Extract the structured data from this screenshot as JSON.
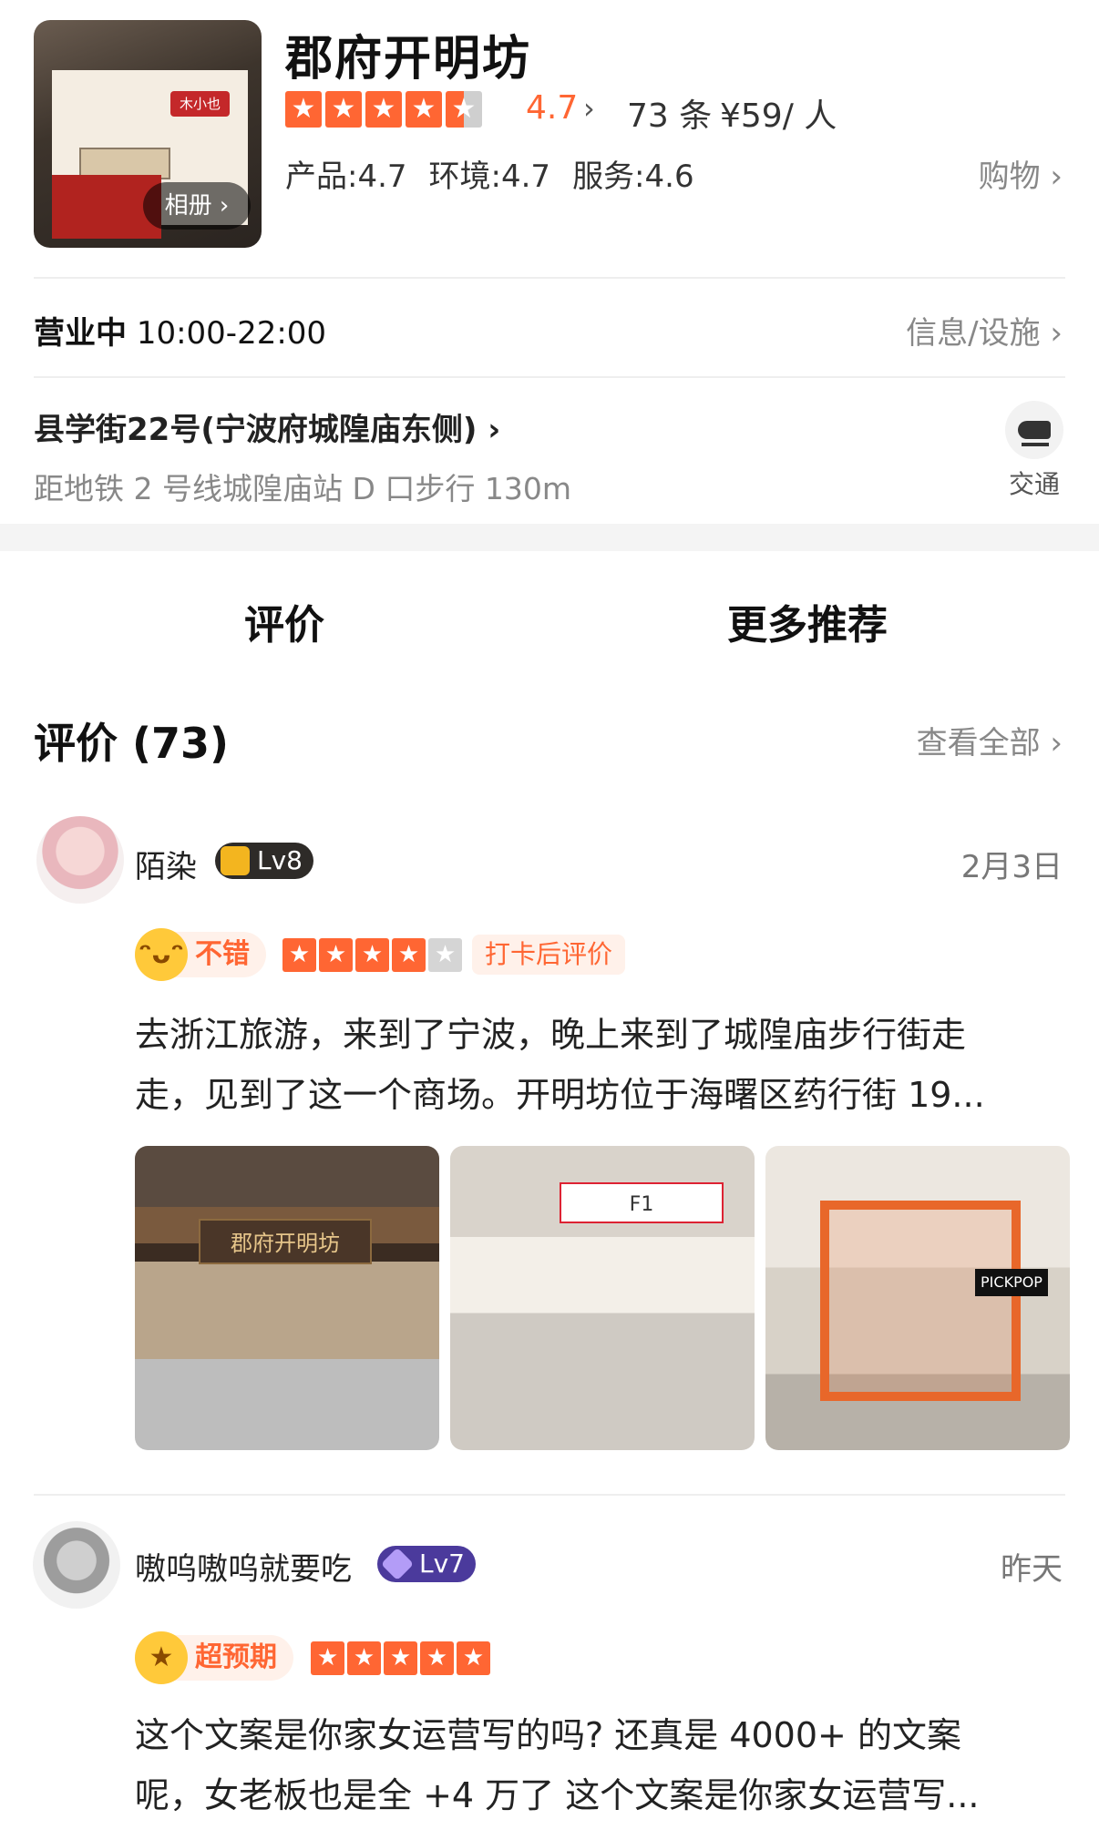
{
  "shop": {
    "name": "郡府开明坊",
    "album_label": "相册 ›",
    "thumb_sign": "木小也",
    "rating": "4.7",
    "rating_chevron": "›",
    "review_count": "73 条",
    "price": "¥59/ 人",
    "scores": {
      "product": "产品:4.7",
      "environment": "环境:4.7",
      "service": "服务:4.6"
    },
    "category": "购物 ›",
    "status": "营业中",
    "hours": "10:00-22:00",
    "info_link": "信息/设施 ›",
    "address": "县学街22号(宁波府城隍庙东侧) ›",
    "distance": "距地铁 2 号线城隍庙站 D 口步行 130m",
    "transit_label": "交通"
  },
  "tabs": [
    {
      "label": "评价",
      "active": true
    },
    {
      "label": "更多推荐",
      "active": false
    }
  ],
  "reviews_section": {
    "title": "评价 (73)",
    "view_all": "查看全部 ›"
  },
  "reviews": [
    {
      "user": "陌染",
      "level": "Lv8",
      "date": "2月3日",
      "mood_label": "不错",
      "mood_icon": "grin-face-icon",
      "stars": 4,
      "tag": "打卡后评价",
      "text_line1": "去浙江旅游，来到了宁波，晚上来到了城隍庙步行街走",
      "text_line2": "走，见到了这一个商场。开明坊位于海曙区药行街 19...",
      "photos": [
        {
          "caption": "郡府开明坊"
        },
        {
          "caption": "F1"
        },
        {
          "caption": "PICKPOP"
        }
      ]
    },
    {
      "user": "嗷呜嗷呜就要吃",
      "level": "Lv7",
      "date": "昨天",
      "mood_label": "超预期",
      "mood_icon": "star-struck-face-icon",
      "stars": 5,
      "text_line1": "这个文案是你家女运营写的吗? 还真是 4000+ 的文案",
      "text_line2": "呢，女老板也是全 +4 万了 这个文案是你家女运营写..."
    }
  ],
  "colors": {
    "accent": "#ff6633",
    "muted_text": "#888888",
    "divider": "#eeeeee"
  }
}
